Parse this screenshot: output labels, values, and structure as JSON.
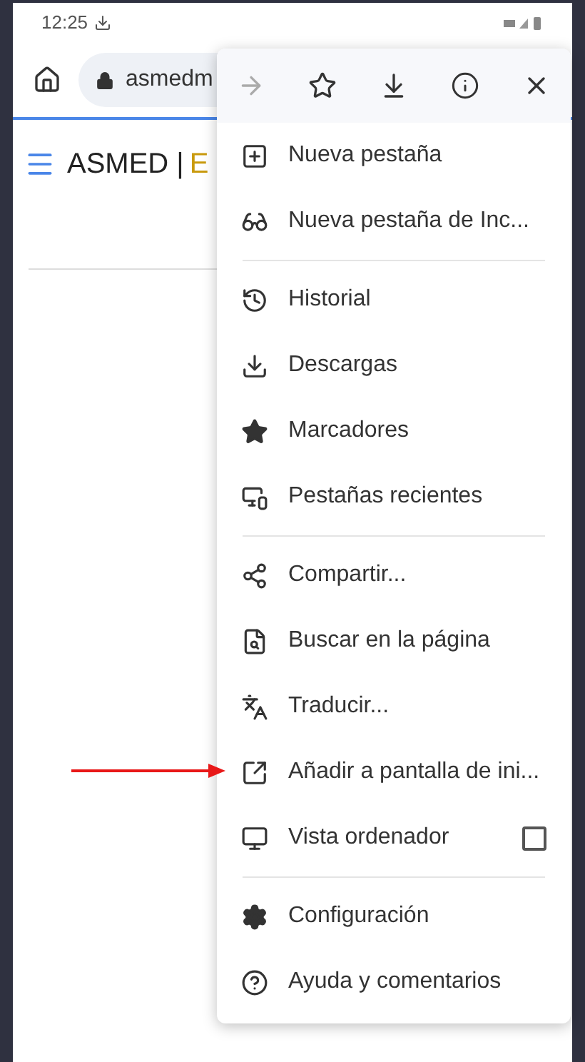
{
  "status_bar": {
    "time": "12:25"
  },
  "address_bar": {
    "url": "asmedm"
  },
  "page": {
    "title": "ASMED |",
    "title_accent": "E"
  },
  "menu": {
    "toolbar": [
      {
        "disabled": true
      },
      {
        "disabled": false
      },
      {
        "disabled": false
      },
      {
        "disabled": false
      },
      {
        "disabled": false
      }
    ],
    "items": [
      {
        "kind": "item",
        "label": "Nueva pestaña"
      },
      {
        "kind": "item",
        "label": "Nueva pestaña de Inc..."
      },
      {
        "kind": "divider"
      },
      {
        "kind": "item",
        "label": "Historial"
      },
      {
        "kind": "item",
        "label": "Descargas"
      },
      {
        "kind": "item",
        "label": "Marcadores"
      },
      {
        "kind": "item",
        "label": "Pestañas recientes"
      },
      {
        "kind": "divider"
      },
      {
        "kind": "item",
        "label": "Compartir..."
      },
      {
        "kind": "item",
        "label": "Buscar en la página"
      },
      {
        "kind": "item",
        "label": "Traducir..."
      },
      {
        "kind": "item",
        "label": "Añadir a pantalla de ini..."
      },
      {
        "kind": "checkbox",
        "label": "Vista ordenador",
        "checked": false
      },
      {
        "kind": "divider"
      },
      {
        "kind": "item",
        "label": "Configuración"
      },
      {
        "kind": "item",
        "label": "Ayuda y comentarios"
      }
    ]
  }
}
